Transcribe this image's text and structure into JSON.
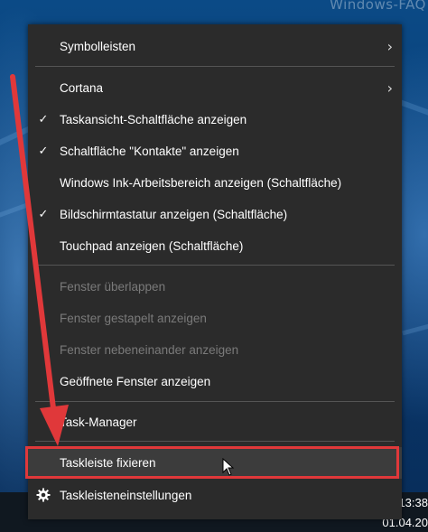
{
  "watermark": "Windows-FAQ",
  "menu": {
    "items": [
      {
        "label": "Symbolleisten",
        "checked": false,
        "disabled": false,
        "submenu": true
      },
      {
        "label": "Cortana",
        "checked": false,
        "disabled": false,
        "submenu": true
      },
      {
        "label": "Taskansicht-Schaltfläche anzeigen",
        "checked": true,
        "disabled": false
      },
      {
        "label": "Schaltfläche \"Kontakte\" anzeigen",
        "checked": true,
        "disabled": false
      },
      {
        "label": "Windows Ink-Arbeitsbereich anzeigen (Schaltfläche)",
        "checked": false,
        "disabled": false
      },
      {
        "label": "Bildschirmtastatur anzeigen (Schaltfläche)",
        "checked": true,
        "disabled": false
      },
      {
        "label": "Touchpad anzeigen (Schaltfläche)",
        "checked": false,
        "disabled": false
      },
      {
        "label": "Fenster überlappen",
        "checked": false,
        "disabled": true
      },
      {
        "label": "Fenster gestapelt anzeigen",
        "checked": false,
        "disabled": true
      },
      {
        "label": "Fenster nebeneinander anzeigen",
        "checked": false,
        "disabled": true
      },
      {
        "label": "Geöffnete Fenster anzeigen",
        "checked": false,
        "disabled": false
      },
      {
        "label": "Task-Manager",
        "checked": false,
        "disabled": false
      },
      {
        "label": "Taskleiste fixieren",
        "checked": false,
        "disabled": false,
        "highlighted": true
      },
      {
        "label": "Taskleisteneinstellungen",
        "checked": false,
        "disabled": false,
        "icon": "gear-icon"
      }
    ],
    "check_glyph": "✓",
    "submenu_glyph": "›"
  },
  "taskbar": {
    "time": "13:38",
    "date": "01.04.20"
  },
  "colors": {
    "menu_bg": "#2b2b2b",
    "highlight_border": "#e0383a",
    "arrow": "#e0383a"
  }
}
